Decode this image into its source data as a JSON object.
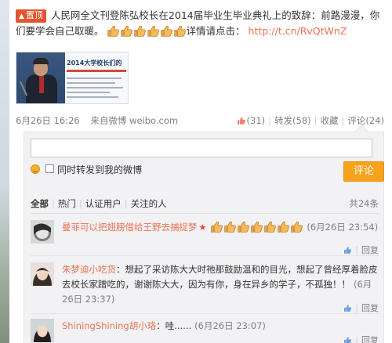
{
  "post": {
    "pin_label": "置顶",
    "text": "人民网全文刊登陈弘校长在2014届毕业生毕业典礼上的致辞：前路漫漫，你们要学会自己取暖。",
    "details_label": "详情请点击：",
    "link_text": "http://t.cn/RvQtWnZ",
    "thumb_count": 6,
    "preview_title": "2014大学校长们的"
  },
  "meta": {
    "date": "6月26日 16:26",
    "source": "来自微博 weibo.com",
    "likes": "(31)",
    "repost": "转发(58)",
    "favorite": "收藏",
    "comments": "评论(24)"
  },
  "composer": {
    "placeholder": "",
    "also_repost_label": "同时转发到我的微博",
    "submit_label": "评论"
  },
  "filter": {
    "all": "全部",
    "hot": "热门",
    "verified": "认证用户",
    "following": "关注的人",
    "total": "共24条"
  },
  "comments": [
    {
      "user": "曼菲可以把翅膀借给王野去捕捉梦",
      "text": "",
      "thumbs": 7,
      "time": "(6月26日 23:54)",
      "reply": "回复"
    },
    {
      "user": "朱梦迪小吃货",
      "text": "：想起了采访陈大大时祂那鼓励温和的目光，想起了曾经厚着脸皮去校长家蹭吃的，谢谢陈大大，因为有你，身在异乡的学子，不孤独！！",
      "time": "(6月26日 23:37)",
      "reply": "回复"
    },
    {
      "user": "ShiningShining胡小珞",
      "text": "：哇......",
      "time": "(6月26日 23:07)",
      "reply": "回复"
    }
  ],
  "colors": {
    "accent": "#eb7350",
    "button": "#f7a21b",
    "pin": "#e1552f",
    "vip": "#e8402b"
  }
}
